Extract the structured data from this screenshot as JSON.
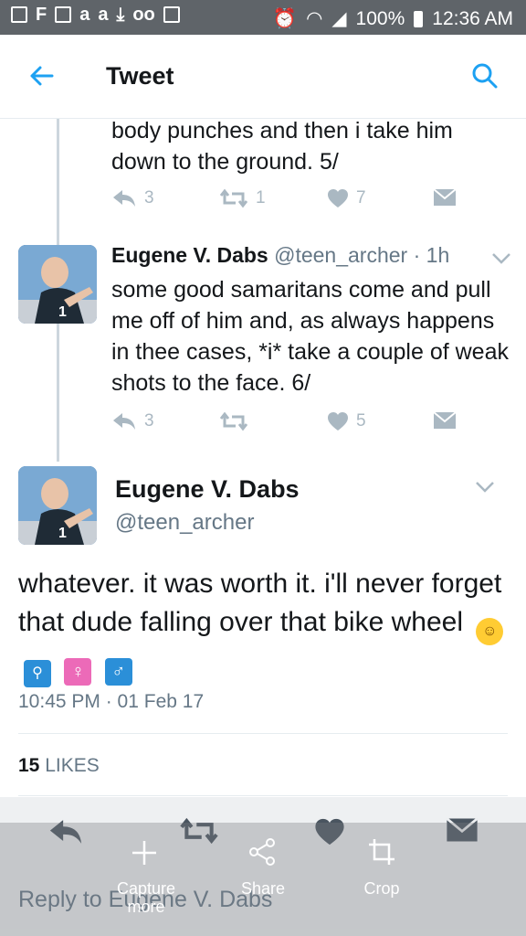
{
  "status_bar": {
    "battery": "100%",
    "time": "12:36 AM"
  },
  "app_bar": {
    "title": "Tweet"
  },
  "tweet_fragment": {
    "text": "body punches and then i take him down to the ground. 5/",
    "replies": "3",
    "retweets": "1",
    "likes": "7"
  },
  "tweet_6": {
    "name": "Eugene V. Dabs",
    "handle": "@teen_archer · 1h",
    "text": "some good samaritans come and pull me off of him and, as always happens in thee cases, *i* take a couple of weak shots to the face. 6/",
    "replies": "3",
    "retweets": "",
    "likes": "5"
  },
  "main_tweet": {
    "name": "Eugene V. Dabs",
    "handle": "@teen_archer",
    "text": "whatever. it was worth it. i'll never forget that dude falling over that bike wheel",
    "timestamp": "10:45 PM · 01 Feb 17",
    "likes_count": "15",
    "likes_label": "LIKES"
  },
  "reply_bar": {
    "placeholder": "Reply to Eugene V. Dabs"
  },
  "overlay": {
    "capture_label": "Capture more",
    "share_label": "Share",
    "crop_label": "Crop"
  },
  "colors": {
    "accent": "#1da1f2",
    "status_bar": "#5f6469",
    "muted": "#657786",
    "icon_muted": "#aab8c2"
  }
}
